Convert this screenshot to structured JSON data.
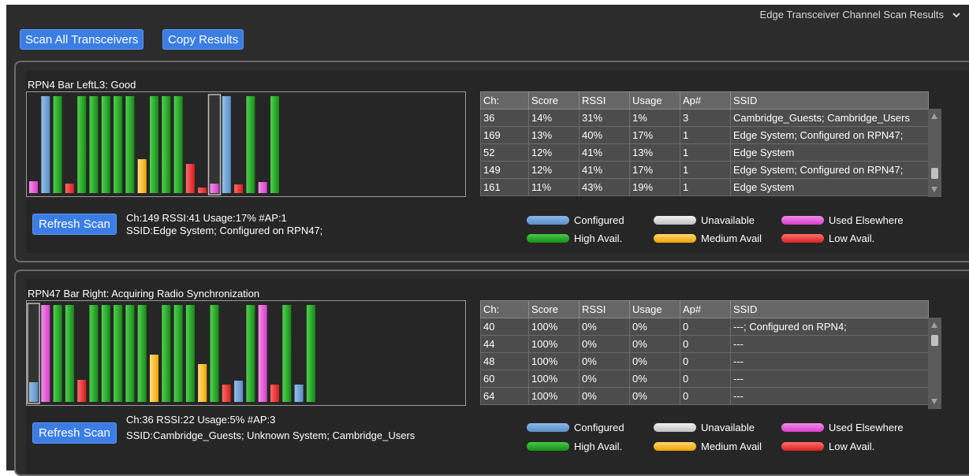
{
  "header": {
    "title": "Edge Transceiver Channel Scan Results"
  },
  "toolbar": {
    "scan_all_label": "Scan All Transceivers",
    "copy_label": "Copy Results"
  },
  "colors": {
    "configured": "#6a9fd6",
    "high": "#1eaa1e",
    "unavailable": "#d9d9d9",
    "medium": "#ffbc28",
    "used_elsewhere": "#e24fd8",
    "low": "#e83838"
  },
  "legend": {
    "configured": "Configured",
    "unavailable": "Unavailable",
    "used_elsewhere": "Used Elsewhere",
    "high": "High Avail.",
    "medium": "Medium Avail",
    "low": "Low Avail."
  },
  "table_headers": [
    "Ch:",
    "Score",
    "RSSI",
    "Usage",
    "Ap#",
    "SSID"
  ],
  "panels": [
    {
      "title": "RPN4  Bar LeftL3: Good",
      "refresh_label": "Refresh Scan",
      "selection_line1": "Ch:149 RSSI:41 Usage:17% #AP:1",
      "selection_line2": "SSID:Edge System; Configured on RPN47;",
      "bars": [
        [
          "pink",
          0.12
        ],
        [
          "config",
          1.0
        ],
        [
          "green",
          1.0
        ],
        [
          "red",
          0.1
        ],
        [
          "green",
          1.0
        ],
        [
          "green",
          1.0
        ],
        [
          "green",
          1.0
        ],
        [
          "green",
          1.0
        ],
        [
          "green",
          1.0
        ],
        [
          "orange",
          0.35
        ],
        [
          "green",
          1.0
        ],
        [
          "green",
          1.0
        ],
        [
          "green",
          1.0
        ],
        [
          "red",
          0.3
        ],
        [
          "red",
          0.06
        ],
        [
          "pink",
          0.1
        ],
        [
          "config",
          1.0
        ],
        [
          "red",
          0.09
        ],
        [
          "green",
          1.0
        ],
        [
          "pink",
          0.11
        ],
        [
          "green",
          1.0
        ]
      ],
      "selected_index": 15,
      "rows": [
        [
          "36",
          "14%",
          "31%",
          "1%",
          "3",
          "Cambridge_Guests; Cambridge_Users"
        ],
        [
          "169",
          "13%",
          "40%",
          "17%",
          "1",
          "Edge System; Configured on RPN47;"
        ],
        [
          "52",
          "12%",
          "41%",
          "13%",
          "1",
          "Edge System"
        ],
        [
          "149",
          "12%",
          "41%",
          "17%",
          "1",
          "Edge System; Configured on RPN47;"
        ],
        [
          "161",
          "11%",
          "43%",
          "19%",
          "1",
          "Edge System"
        ]
      ]
    },
    {
      "title": "RPN47  Bar Right: Acquiring Radio Synchronization",
      "refresh_label": "Refresh Scan",
      "selection_line1": "Ch:36 RSSI:22 Usage:5% #AP:3",
      "selection_line2": "SSID:Cambridge_Guests; Unknown System; Cambridge_Users",
      "bars": [
        [
          "config",
          0.2
        ],
        [
          "pink",
          1.0
        ],
        [
          "green",
          1.0
        ],
        [
          "green",
          1.0
        ],
        [
          "red",
          0.23
        ],
        [
          "green",
          1.0
        ],
        [
          "green",
          1.0
        ],
        [
          "green",
          1.0
        ],
        [
          "green",
          1.0
        ],
        [
          "green",
          1.0
        ],
        [
          "orange",
          0.49
        ],
        [
          "green",
          1.0
        ],
        [
          "green",
          1.0
        ],
        [
          "green",
          1.0
        ],
        [
          "orange",
          0.39
        ],
        [
          "green",
          1.0
        ],
        [
          "red",
          0.18
        ],
        [
          "config",
          0.22
        ],
        [
          "green",
          1.0
        ],
        [
          "pink",
          1.0
        ],
        [
          "red",
          0.18
        ],
        [
          "green",
          1.0
        ],
        [
          "config",
          0.18
        ],
        [
          "green",
          1.0
        ]
      ],
      "selected_index": 0,
      "rows": [
        [
          "40",
          "100%",
          "0%",
          "0%",
          "0",
          "---; Configured on RPN4;"
        ],
        [
          "44",
          "100%",
          "0%",
          "0%",
          "0",
          "---"
        ],
        [
          "48",
          "100%",
          "0%",
          "0%",
          "0",
          "---"
        ],
        [
          "60",
          "100%",
          "0%",
          "0%",
          "0",
          "---"
        ],
        [
          "64",
          "100%",
          "0%",
          "0%",
          "0",
          "---"
        ]
      ]
    }
  ]
}
